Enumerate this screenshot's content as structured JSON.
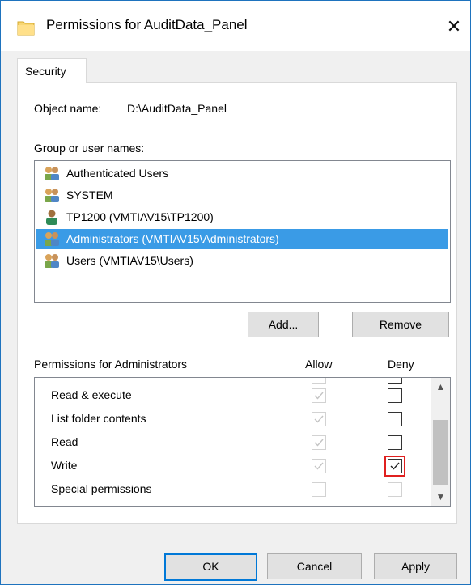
{
  "window": {
    "title": "Permissions for AuditData_Panel",
    "close": "✕"
  },
  "tab": {
    "label": "Security"
  },
  "object": {
    "label": "Object name:",
    "value": "D:\\AuditData_Panel"
  },
  "group": {
    "label": "Group or user names:",
    "users": [
      {
        "name": "Authenticated Users",
        "icon": "group-icon"
      },
      {
        "name": "SYSTEM",
        "icon": "group-icon"
      },
      {
        "name": "TP1200 (VMTIAV15\\TP1200)",
        "icon": "user-icon"
      },
      {
        "name": "Administrators (VMTIAV15\\Administrators)",
        "icon": "group-icon",
        "selected": true
      },
      {
        "name": "Users (VMTIAV15\\Users)",
        "icon": "group-icon"
      }
    ]
  },
  "buttons": {
    "add": "Add...",
    "remove": "Remove",
    "ok": "OK",
    "cancel": "Cancel",
    "apply": "Apply"
  },
  "permissions": {
    "header": "Permissions for Administrators",
    "allow": "Allow",
    "deny": "Deny",
    "rows": [
      {
        "name": "Read & execute",
        "allow": true,
        "allow_disabled": true,
        "deny": false,
        "deny_disabled": false
      },
      {
        "name": "List folder contents",
        "allow": true,
        "allow_disabled": true,
        "deny": false,
        "deny_disabled": false
      },
      {
        "name": "Read",
        "allow": true,
        "allow_disabled": true,
        "deny": false,
        "deny_disabled": false
      },
      {
        "name": "Write",
        "allow": true,
        "allow_disabled": true,
        "deny": true,
        "deny_disabled": false,
        "highlighted": true
      },
      {
        "name": "Special permissions",
        "allow": false,
        "allow_disabled": true,
        "deny": false,
        "deny_disabled": true
      }
    ]
  },
  "colors": {
    "selection": "#3a9be6",
    "highlight": "#e0201f",
    "accent": "#0078d7"
  }
}
